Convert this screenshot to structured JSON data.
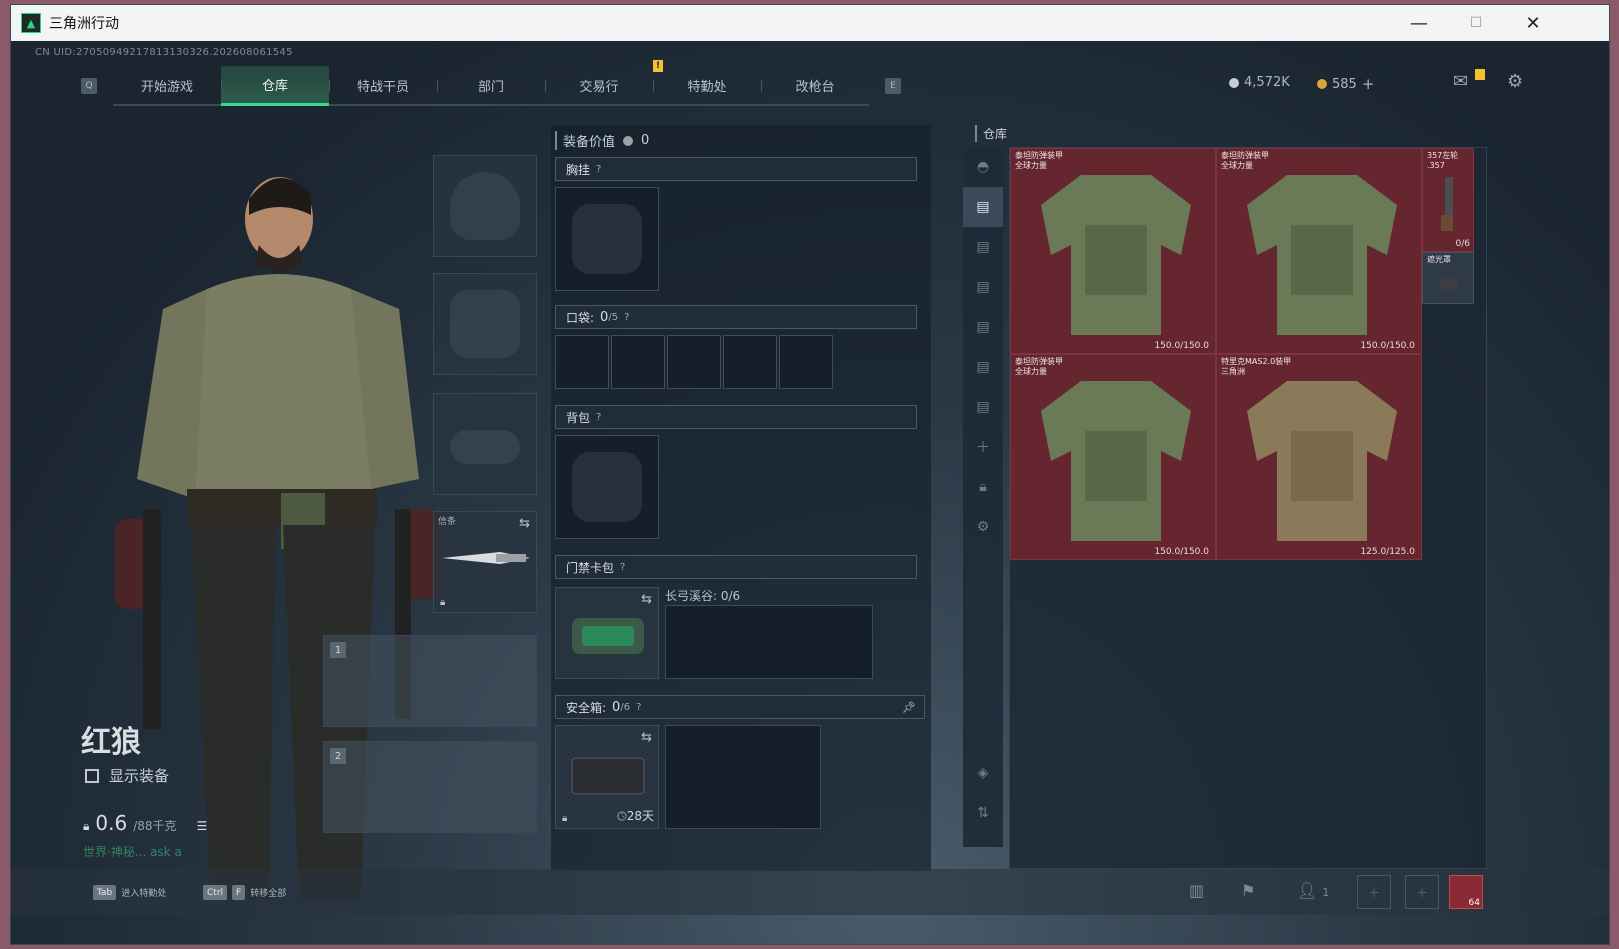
{
  "window": {
    "title": "三角洲行动",
    "minimize": "—",
    "maximize": "☐",
    "close": "✕"
  },
  "uid": "CN UID:27050949217813130326.202608061545",
  "nav": {
    "left_key": "Q",
    "right_key": "E",
    "tabs": [
      "开始游戏",
      "仓库",
      "特战干员",
      "部门",
      "交易行",
      "特勤处",
      "改枪台"
    ],
    "active_tab": "仓库",
    "badge": "!"
  },
  "currency": {
    "silver": "4,572K",
    "gold": "585",
    "add": "+",
    "silver_color": "#c7cdd3",
    "gold_color": "#d8a53a"
  },
  "character": {
    "name": "红狼",
    "show_equipment": "显示装备",
    "weight_value": "0.6",
    "weight_max": "/88千克",
    "hint": "世界·神秘...  ask a"
  },
  "equipment": {
    "melee_label": "信条",
    "slot1": "1",
    "slot2": "2"
  },
  "middle": {
    "equip_value_label": "装备价值",
    "equip_value": "0",
    "chest_rig": "胸挂",
    "pockets": "口袋:",
    "pockets_count": "0",
    "pockets_max": "/5",
    "backpack": "背包",
    "keycard": "门禁卡包",
    "keycard_location": "长弓溪谷: 0/6",
    "safebox": "安全箱:",
    "safebox_count": "0",
    "safebox_max": "/6",
    "safebox_days": "28天",
    "qmark": "?"
  },
  "warehouse": {
    "title": "仓库",
    "items": [
      {
        "name": "泰坦防弹装甲\n全球力量",
        "durability": "150.0/150.0",
        "color": "#6a7a56"
      },
      {
        "name": "泰坦防弹装甲\n全球力量",
        "durability": "150.0/150.0",
        "color": "#6a7a56"
      },
      {
        "name": "泰坦防弹装甲\n全球力量",
        "durability": "150.0/150.0",
        "color": "#6a7a56"
      },
      {
        "name": "特里克MAS2.0装甲\n三角洲",
        "durability": "125.0/125.0",
        "color": "#8a7a5a"
      }
    ],
    "revolver": {
      "name": "357左轮\n.357",
      "ammo": "0/6"
    },
    "muzzle": {
      "name": "遮光罩"
    }
  },
  "bottom": {
    "tab_key": "Tab",
    "tab_label": "进入特勤处",
    "ctrl_key": "Ctrl",
    "f_key": "F",
    "ctrl_label": "转移全部",
    "squad_count": "1",
    "level": "64"
  }
}
